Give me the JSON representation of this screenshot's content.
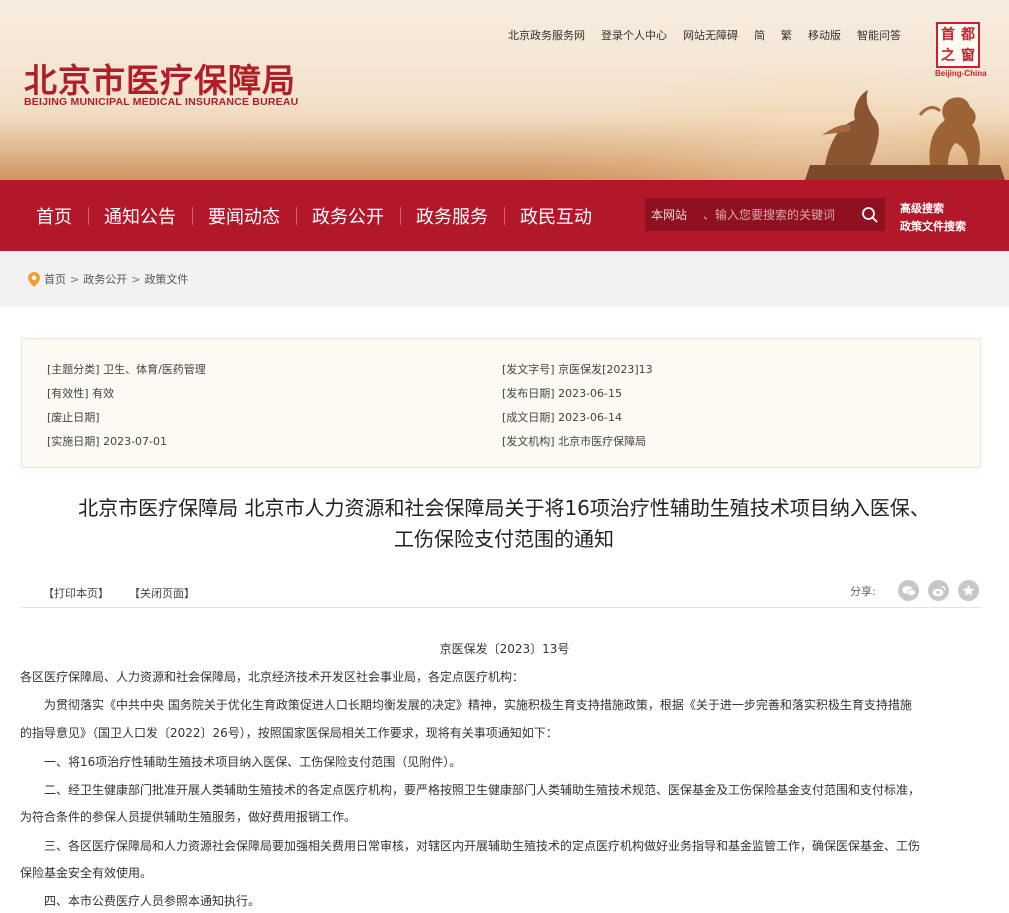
{
  "header": {
    "logo_cn": "北京市医疗保障局",
    "logo_en": "BEIJING MUNICIPAL MEDICAL INSURANCE BUREAU",
    "top_links": [
      "北京政务服务网",
      "登录个人中心",
      "网站无障碍",
      "简",
      "繁",
      "移动版",
      "智能问答"
    ],
    "seal_chars": [
      "首",
      "都",
      "之",
      "窗"
    ],
    "seal_label": "Beijing-China"
  },
  "nav": {
    "items": [
      "首页",
      "通知公告",
      "要闻动态",
      "政务公开",
      "政务服务",
      "政民互动"
    ],
    "search_scope": "本网站",
    "search_placeholder": "、输入您要搜索的关键词",
    "advanced_search": "高级搜索",
    "policy_search": "政策文件搜索"
  },
  "breadcrumb": {
    "items": [
      "首页",
      "政务公开",
      "政策文件"
    ],
    "separator": ">"
  },
  "meta": {
    "left": [
      {
        "label": "[主题分类]",
        "value": "卫生、体育/医药管理"
      },
      {
        "label": "[有效性]",
        "value": "有效"
      },
      {
        "label": "[废止日期]",
        "value": ""
      },
      {
        "label": "[实施日期]",
        "value": "2023-07-01"
      }
    ],
    "right": [
      {
        "label": "[发文字号]",
        "value": "京医保发[2023]13"
      },
      {
        "label": "[发布日期]",
        "value": "2023-06-15"
      },
      {
        "label": "[成文日期]",
        "value": "2023-06-14"
      },
      {
        "label": "[发文机构]",
        "value": "北京市医疗保障局"
      }
    ]
  },
  "article": {
    "title_line1": "北京市医疗保障局 北京市人力资源和社会保障局关于将16项治疗性辅助生殖技术项目纳入医保、",
    "title_line2": "工伤保险支付范围的通知",
    "print_label": "【打印本页】",
    "close_label": "【关闭页面】",
    "share_label": "分享:",
    "doc_number": "京医保发〔2023〕13号",
    "paragraphs": [
      "各区医疗保障局、人力资源和社会保障局，北京经济技术开发区社会事业局，各定点医疗机构：",
      "为贯彻落实《中共中央 国务院关于优化生育政策促进人口长期均衡发展的决定》精神，实施积极生育支持措施政策，根据《关于进一步完善和落实积极生育支持措施",
      "的指导意见》（国卫人口发〔2022〕26号），按照国家医保局相关工作要求，现将有关事项通知如下：",
      "一、将16项治疗性辅助生殖技术项目纳入医保、工伤保险支付范围（见附件）。",
      "二、经卫生健康部门批准开展人类辅助生殖技术的各定点医疗机构，要严格按照卫生健康部门人类辅助生殖技术规范、医保基金及工伤保险基金支付范围和支付标准，",
      "为符合条件的参保人员提供辅助生殖服务，做好费用报销工作。",
      "三、各区医疗保障局和人力资源社会保障局要加强相关费用日常审核，对辖区内开展辅助生殖技术的定点医疗机构做好业务指导和基金监管工作，确保医保基金、工伤",
      "保险基金安全有效使用。",
      "四、本市公费医疗人员参照本通知执行。"
    ]
  },
  "colors": {
    "brand_red": "#b3182a",
    "logo_red": "#b01e2a"
  }
}
